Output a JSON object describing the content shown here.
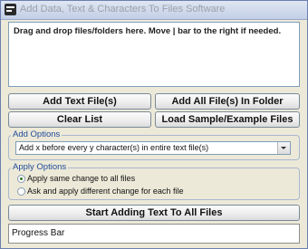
{
  "window": {
    "title": "Add Data, Text & Characters To Files Software",
    "icon": "app-icon"
  },
  "dropzone": {
    "label": "Drag and drop files/folders here. Move | bar to the right if needed."
  },
  "buttons": {
    "add_text_files": "Add Text File(s)",
    "add_all_files_in_folder": "Add All File(s) In Folder",
    "clear_list": "Clear List",
    "load_sample": "Load Sample/Example Files",
    "start": "Start Adding Text To All Files"
  },
  "add_options": {
    "legend": "Add Options",
    "selected": "Add x before every y character(s) in entire text file(s)"
  },
  "apply_options": {
    "legend": "Apply Options",
    "radio1": "Apply same change to all files",
    "radio2": "Ask and apply different change for each file",
    "selected_index": 0
  },
  "progress": {
    "label": "Progress Bar",
    "value": 0
  },
  "colors": {
    "window_bg": "#ece9d8",
    "group_border": "#a9b8cf",
    "legend_text": "#1f4a9a"
  }
}
